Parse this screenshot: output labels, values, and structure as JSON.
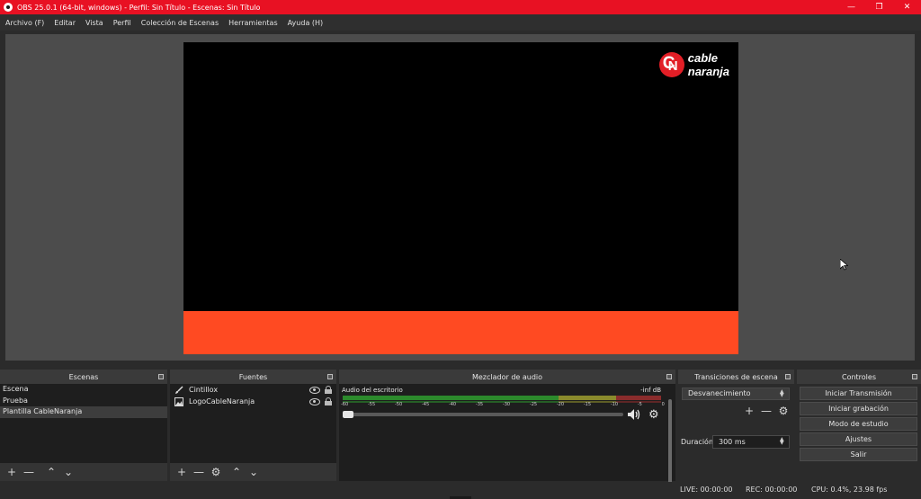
{
  "window": {
    "title": "OBS 25.0.1 (64-bit, windows) - Perfil: Sin Título - Escenas: Sin Título"
  },
  "menu": [
    "Archivo (F)",
    "Editar",
    "Vista",
    "Perfil",
    "Colección de Escenas",
    "Herramientas",
    "Ayuda (H)"
  ],
  "preview": {
    "logo_text_1": "cable",
    "logo_text_2": "naranja",
    "ticker_color": "#ff4a22"
  },
  "scenes": {
    "title": "Escenas",
    "items": [
      "Escena",
      "Prueba",
      "Plantilla CableNaranja"
    ],
    "selected_index": 2
  },
  "sources": {
    "title": "Fuentes",
    "items": [
      {
        "name": "Cintillox",
        "icon": "brush-icon"
      },
      {
        "name": "LogoCableNaranja",
        "icon": "image-icon"
      }
    ]
  },
  "mixer": {
    "title": "Mezclador de audio",
    "channel": "Audio del escritorio",
    "level": "-inf dB",
    "ticks": [
      "-60",
      "-55",
      "-50",
      "-45",
      "-40",
      "-35",
      "-30",
      "-25",
      "-20",
      "-15",
      "-10",
      "-5",
      "0"
    ]
  },
  "transitions": {
    "title": "Transiciones de escena",
    "selected": "Desvanecimiento",
    "duration_label": "Duración",
    "duration_value": "300 ms"
  },
  "controls": {
    "title": "Controles",
    "buttons": [
      "Iniciar Transmisión",
      "Iniciar grabación",
      "Modo de estudio",
      "Ajustes",
      "Salir"
    ]
  },
  "status": {
    "live": "LIVE: 00:00:00",
    "rec": "REC: 00:00:00",
    "cpu": "CPU: 0.4%, 23.98 fps"
  }
}
